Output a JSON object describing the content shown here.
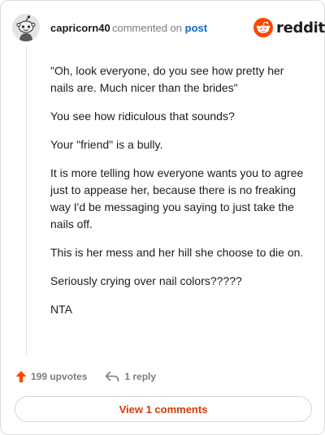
{
  "header": {
    "username": "capricorn40",
    "action_text": "commented on",
    "post_link": "post",
    "logo_text": "reddit"
  },
  "comment": {
    "paragraphs": [
      "\"Oh, look everyone, do you see how pretty her nails are. Much nicer than the brides\"",
      "You see how ridiculous that sounds?",
      "Your \"friend\" is a bully.",
      "It is more telling how everyone wants you to agree just to appease her, because there is no freaking way I'd be messaging you saying to just take the nails off.",
      "This is her mess and her hill she choose to die on.",
      "Seriously crying over nail colors?????",
      "NTA"
    ]
  },
  "actions": {
    "upvotes": "199 upvotes",
    "replies": "1 reply"
  },
  "view_comments": "View 1 comments",
  "colors": {
    "brand": "#ff4500",
    "link": "#0a6cc9",
    "view_button_text": "#d93900"
  }
}
